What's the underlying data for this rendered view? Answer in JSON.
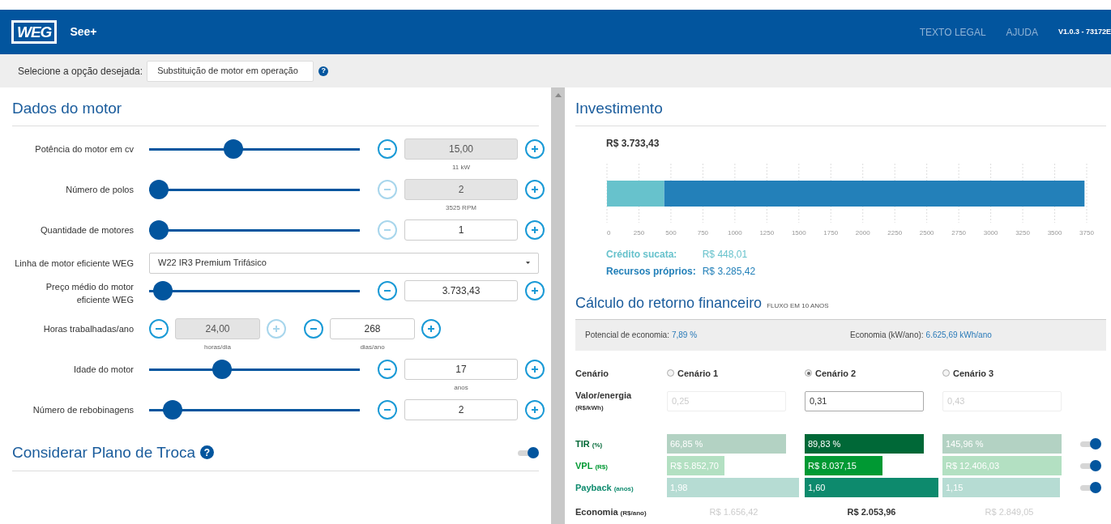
{
  "header": {
    "logo": "WEG",
    "app_name": "See+",
    "links": [
      "TEXTO LEGAL",
      "AJUDA"
    ],
    "version": "V1.0.3 - 73172E"
  },
  "option_bar": {
    "label": "Selecione a opção desejada:",
    "value": "Substituição de motor em operação",
    "help": "?"
  },
  "motor": {
    "title": "Dados do motor",
    "rows": [
      {
        "kind": "slider",
        "label": "Potência do motor em cv",
        "level": 0.39,
        "value": "15,00",
        "readonly": true,
        "minus_disabled": false,
        "unit": "11 kW"
      },
      {
        "kind": "slider",
        "label": "Número de polos",
        "level": 0,
        "value": "2",
        "readonly": true,
        "minus_disabled": true,
        "unit": "3525 RPM"
      },
      {
        "kind": "slider",
        "label": "Quantidade de motores",
        "level": 0,
        "value": "1",
        "readonly": false,
        "minus_disabled": true
      },
      {
        "kind": "select",
        "label": "Linha de motor eficiente WEG",
        "value": "W22 IR3 Premium Trifásico"
      },
      {
        "kind": "slider",
        "label": "Preço médio do motor eficiente WEG",
        "level": 0.02,
        "value": "3.733,43",
        "readonly": false,
        "minus_disabled": false
      },
      {
        "kind": "pair",
        "label": "Horas trabalhadas/ano",
        "fields": [
          {
            "value": "24,00",
            "readonly": true,
            "unit": "horas/dia"
          },
          {
            "value": "268",
            "readonly": false,
            "unit": "dias/ano"
          }
        ]
      },
      {
        "kind": "slider",
        "label": "Idade do motor",
        "level": 0.33,
        "value": "17",
        "readonly": false,
        "minus_disabled": false,
        "unit": "anos"
      },
      {
        "kind": "slider",
        "label": "Número de rebobinagens",
        "level": 0.07,
        "value": "2",
        "readonly": false,
        "minus_disabled": false
      }
    ]
  },
  "exchange_plan": {
    "title": "Considerar Plano de Troca",
    "help": "?",
    "on": true
  },
  "investment": {
    "title": "Investimento",
    "total": "R$ 3.733,43",
    "chart_data": {
      "type": "bar",
      "orientation": "horizontal",
      "stacked": true,
      "grid": true,
      "series": [
        {
          "name": "Crédito sucata:",
          "color": "#67c2cc",
          "values": [
            448
          ]
        },
        {
          "name": "Recursos próprios:",
          "color": "#2380b9",
          "values": [
            3285
          ]
        }
      ],
      "xlim": [
        0,
        3750
      ],
      "xticks": [
        0,
        250,
        500,
        750,
        1000,
        1250,
        1500,
        1750,
        2000,
        2250,
        2500,
        2750,
        3000,
        3250,
        3500,
        3750
      ]
    },
    "legend": [
      {
        "value": "R$ 448,01"
      },
      {
        "value": "R$ 3.285,42"
      }
    ]
  },
  "financial": {
    "title": "Cálculo do retorno financeiro",
    "subtitle": "FLUXO EM 10 ANOS",
    "summary": [
      {
        "label": "Potencial de economia:",
        "value": "7,89 %"
      },
      {
        "label": "Economia (kW/ano):",
        "value": "6.625,69 kWh/ano"
      }
    ],
    "scenario_label": "Cenário",
    "energy_label": "Valor/energia",
    "energy_unit": "(R$/kWh)",
    "scenarios": [
      {
        "label": "Cenário 1",
        "selected": false,
        "energy": "0,25"
      },
      {
        "label": "Cenário 2",
        "selected": true,
        "energy": "0,31"
      },
      {
        "label": "Cenário 3",
        "selected": false,
        "energy": "0,43"
      }
    ],
    "metrics": [
      {
        "label": "TIR",
        "unit": "(%)",
        "color": "#006837",
        "on": true,
        "values": [
          "66,85 %",
          "89,83 %",
          "145,96 %"
        ]
      },
      {
        "label": "VPL",
        "unit": "(R$)",
        "color": "#009933",
        "on": true,
        "values": [
          "R$ 5.852,70",
          "R$ 8.037,15",
          "R$ 12.406,03"
        ]
      },
      {
        "label": "Payback",
        "unit": "(anos)",
        "color": "#0d8a6d",
        "on": true,
        "values": [
          "1,98",
          "1,60",
          "1,15"
        ]
      }
    ],
    "economy": {
      "label": "Economia",
      "unit": "(R$/ano)",
      "values": [
        "R$ 1.656,42",
        "R$ 2.053,96",
        "R$ 2.849,05"
      ]
    }
  }
}
